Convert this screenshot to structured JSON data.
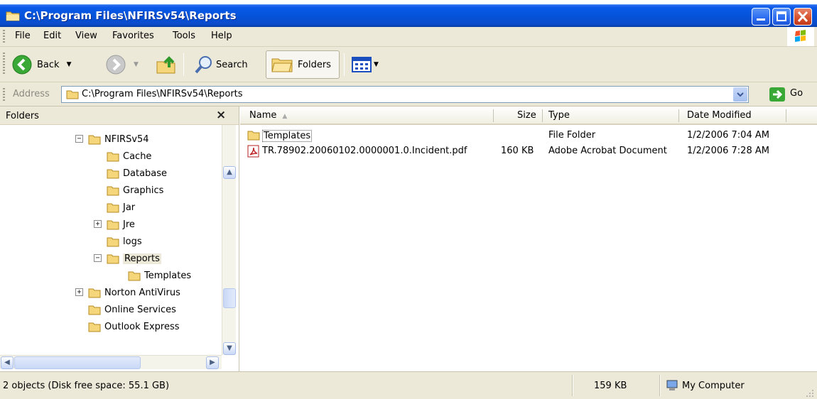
{
  "window": {
    "title": "C:\\Program Files\\NFIRSv54\\Reports"
  },
  "menu": {
    "items": [
      "File",
      "Edit",
      "View",
      "Favorites",
      "Tools",
      "Help"
    ]
  },
  "toolbar": {
    "back_label": "Back",
    "search_label": "Search",
    "folders_label": "Folders"
  },
  "address": {
    "label": "Address",
    "value": "C:\\Program Files\\NFIRSv54\\Reports",
    "go_label": "Go"
  },
  "folders_pane": {
    "title": "Folders",
    "close": "×",
    "tree": [
      {
        "label": "NFIRSv54",
        "expander": "−"
      },
      {
        "label": "Cache"
      },
      {
        "label": "Database"
      },
      {
        "label": "Graphics"
      },
      {
        "label": "Jar"
      },
      {
        "label": "Jre",
        "expander": "+"
      },
      {
        "label": "logs"
      },
      {
        "label": "Reports",
        "expander": "−",
        "selected": true
      },
      {
        "label": "Templates"
      },
      {
        "label": "Norton AntiVirus",
        "expander": "+"
      },
      {
        "label": "Online Services"
      },
      {
        "label": "Outlook Express"
      }
    ]
  },
  "file_list": {
    "columns": [
      "Name",
      "Size",
      "Type",
      "Date Modified"
    ],
    "rows": [
      {
        "name": "Templates",
        "size": "",
        "type": "File Folder",
        "modified": "1/2/2006 7:04 AM",
        "icon": "folder-icon"
      },
      {
        "name": "TR.78902.20060102.0000001.0.Incident.pdf",
        "size": "160 KB",
        "type": "Adobe Acrobat Document",
        "modified": "1/2/2006 7:28 AM",
        "icon": "pdf-icon"
      }
    ]
  },
  "status": {
    "objects": "2 objects (Disk free space: 55.1 GB)",
    "size": "159 KB",
    "zone": "My Computer"
  },
  "colors": {
    "titlebar": "#0453da",
    "chrome": "#ece9d8",
    "folder": "#f5d67a"
  }
}
